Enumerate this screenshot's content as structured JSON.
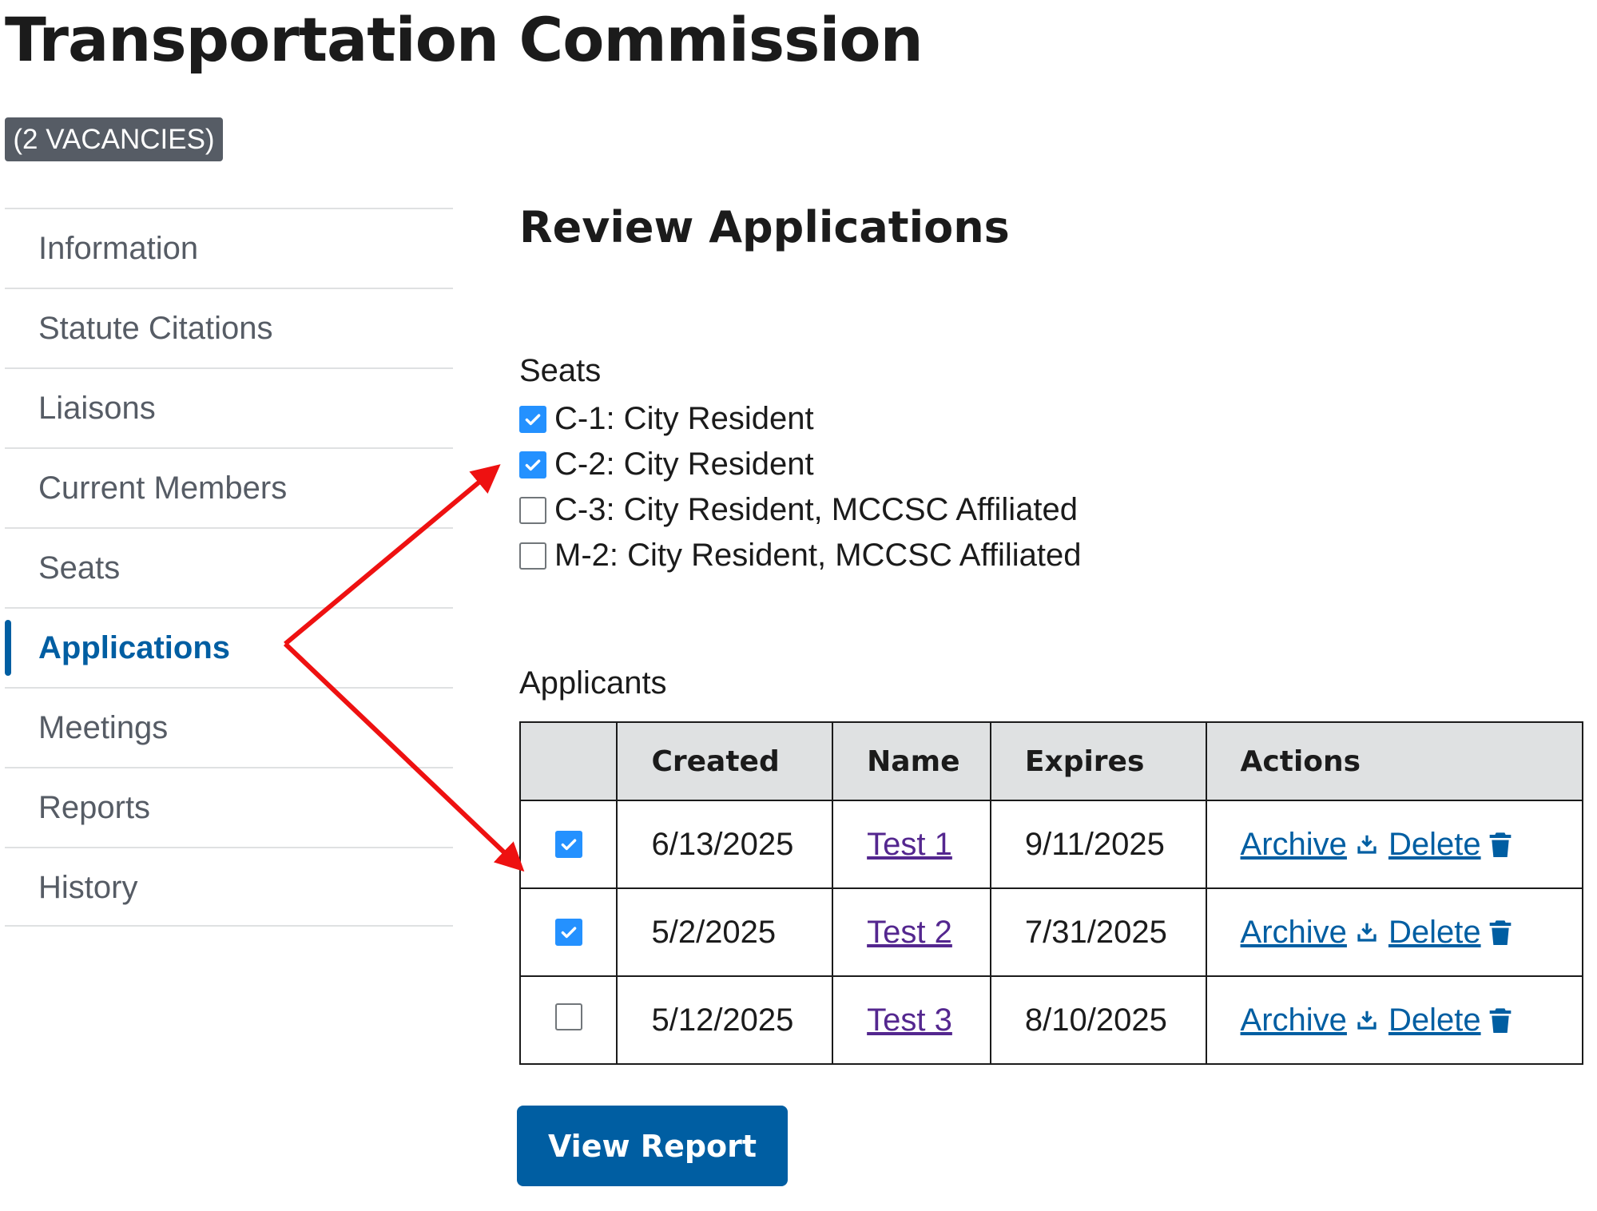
{
  "page": {
    "title": "Transportation Commission",
    "vacancy_badge": "(2 VACANCIES)"
  },
  "sidebar": {
    "items": [
      {
        "label": "Information",
        "active": false
      },
      {
        "label": "Statute Citations",
        "active": false
      },
      {
        "label": "Liaisons",
        "active": false
      },
      {
        "label": "Current Members",
        "active": false
      },
      {
        "label": "Seats",
        "active": false
      },
      {
        "label": "Applications",
        "active": true
      },
      {
        "label": "Meetings",
        "active": false
      },
      {
        "label": "Reports",
        "active": false
      },
      {
        "label": "History",
        "active": false
      }
    ]
  },
  "main": {
    "title": "Review Applications",
    "seats_label": "Seats",
    "seats": [
      {
        "label": "C-1: City Resident",
        "checked": true
      },
      {
        "label": "C-2: City Resident",
        "checked": true
      },
      {
        "label": "C-3: City Resident, MCCSC Affiliated",
        "checked": false
      },
      {
        "label": "M-2: City Resident, MCCSC Affiliated",
        "checked": false
      }
    ],
    "applicants_label": "Applicants",
    "table": {
      "headers": [
        "",
        "Created",
        "Name",
        "Expires",
        "Actions"
      ],
      "rows": [
        {
          "checked": true,
          "created": "6/13/2025",
          "name": "Test 1",
          "expires": "9/11/2025",
          "archive": "Archive",
          "delete": "Delete"
        },
        {
          "checked": true,
          "created": "5/2/2025",
          "name": "Test 2",
          "expires": "7/31/2025",
          "archive": "Archive",
          "delete": "Delete"
        },
        {
          "checked": false,
          "created": "5/12/2025",
          "name": "Test 3",
          "expires": "8/10/2025",
          "archive": "Archive",
          "delete": "Delete"
        }
      ]
    },
    "view_report_label": "View Report"
  },
  "icons": {
    "archive": "download-icon",
    "delete": "trash-icon",
    "checkbox_checked": "checkmark-icon"
  },
  "colors": {
    "primary": "#005ea2",
    "checkbox": "#2491ff",
    "visited_link": "#54278f",
    "badge": "#565c65",
    "annotation_arrow": "#ee1111"
  }
}
